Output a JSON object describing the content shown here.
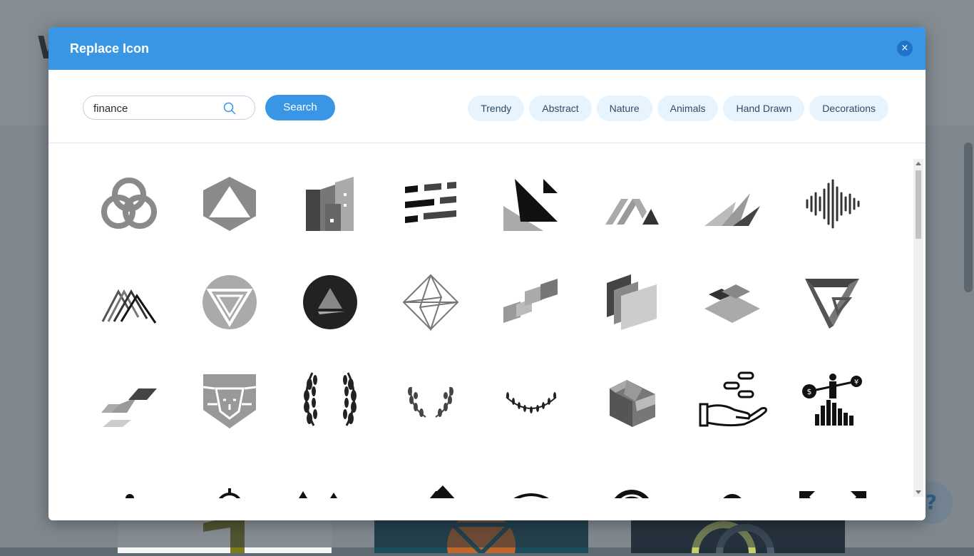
{
  "modal": {
    "title": "Replace Icon",
    "close_label": "×"
  },
  "search": {
    "value": "finance",
    "button_label": "Search"
  },
  "categories": [
    "Trendy",
    "Abstract",
    "Nature",
    "Animals",
    "Hand Drawn",
    "Decorations"
  ],
  "icons": [
    "venn-circles-icon",
    "hexagon-triangle-icon",
    "buildings-icon",
    "striped-blocks-icon",
    "triangles-icon",
    "zigzag-m-icon",
    "sail-peaks-icon",
    "sound-wave-icon",
    "mountain-lines-icon",
    "inverted-triangle-circle-icon",
    "dark-circle-triangle-icon",
    "wire-octahedron-icon",
    "parallelogram-steps-icon",
    "layered-panels-icon",
    "diamond-layers-icon",
    "impossible-triangle-icon",
    "parallelogram-pair-icon",
    "lion-shield-icon",
    "laurel-wreath-large-icon",
    "laurel-wreath-small-icon",
    "laurel-arc-icon",
    "isometric-block-icon",
    "hand-coins-icon",
    "currency-balance-bars-icon",
    "currency-tug-icon",
    "dollar-network-icon",
    "dollar-growth-arrow-icon",
    "dollar-bag-arrow-icon",
    "dollar-dome-icon",
    "pound-coin-icon",
    "dollar-barbell-icon",
    "dollar-arrows-icon"
  ],
  "background": {
    "mark": "W",
    "help_label": "?"
  },
  "colors": {
    "header": "#3996e5",
    "accent": "#3996e5",
    "chip_bg": "#e7f3fd"
  }
}
